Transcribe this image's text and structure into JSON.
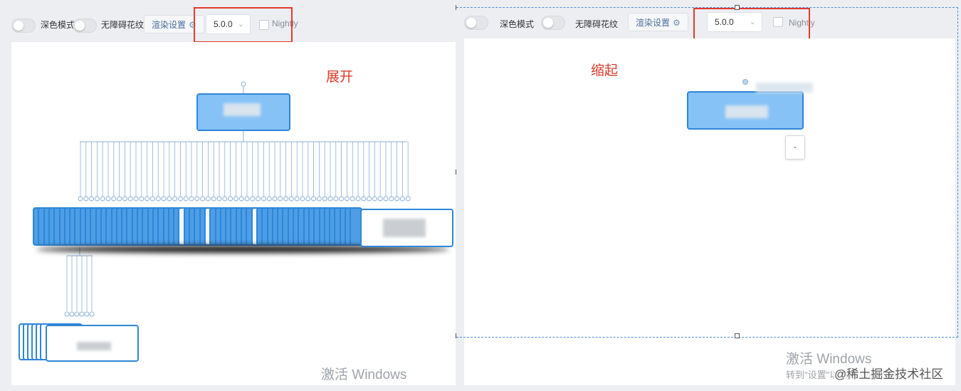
{
  "toolbar": {
    "dark_mode_label": "深色模式",
    "accessible_label": "无障碍花纹",
    "render_settings_label": "渲染设置",
    "version_value": "5.0.0",
    "nightly_label": "Nightly"
  },
  "annotations": {
    "expanded": "展开",
    "collapsed": "缩起"
  },
  "collapse_button": "-",
  "watermarks": {
    "activate_windows": "激活 Windows",
    "activate_hint": "转到\"设置\"以激活 Windows。",
    "community": "@稀土掘金技术社区"
  },
  "colors": {
    "node_fill": "#86c2f6",
    "node_border": "#2f86d8",
    "annotation": "#d93a2a",
    "highlight_box": "#e23a2c"
  }
}
